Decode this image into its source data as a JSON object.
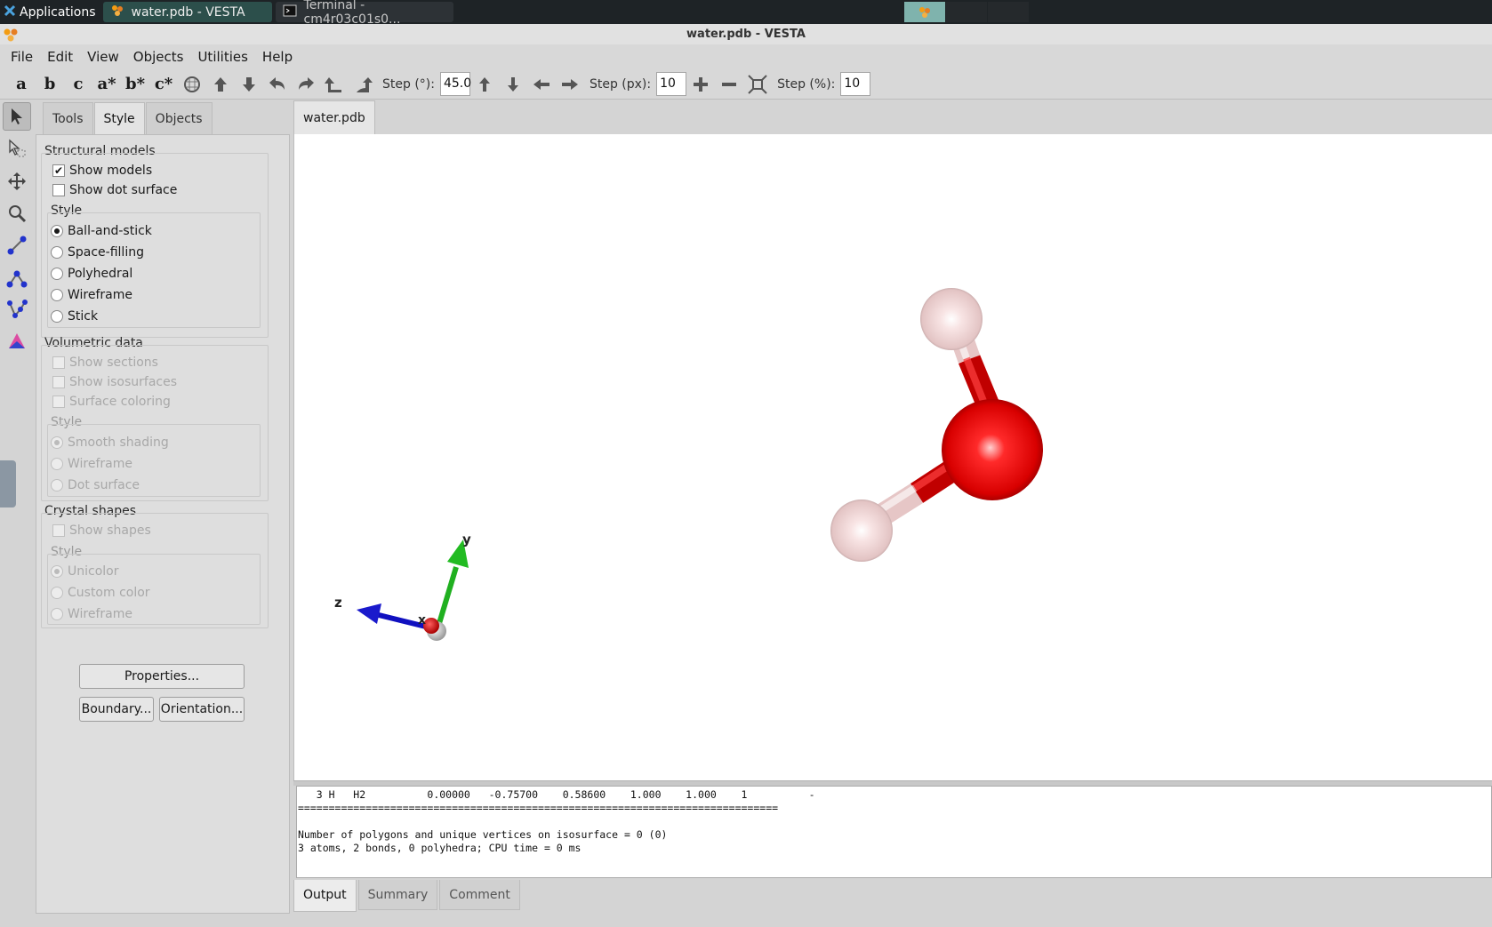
{
  "taskbar": {
    "apps_label": "Applications",
    "tasks": [
      {
        "label": "water.pdb - VESTA",
        "active": true
      },
      {
        "label": "Terminal - cm4r03c01s0...",
        "active": false
      }
    ]
  },
  "window": {
    "title": "water.pdb - VESTA"
  },
  "menu": [
    "File",
    "Edit",
    "View",
    "Objects",
    "Utilities",
    "Help"
  ],
  "toolbar": {
    "axis_buttons": [
      "a",
      "b",
      "c",
      "a*",
      "b*",
      "c*"
    ],
    "step_deg_label": "Step (°):",
    "step_deg_value": "45.0",
    "step_px_label": "Step (px):",
    "step_px_value": "10",
    "step_pct_label": "Step (%):",
    "step_pct_value": "10"
  },
  "panel": {
    "tabs": [
      "Tools",
      "Style",
      "Objects"
    ],
    "active_tab": "Style",
    "structural": {
      "title": "Structural models",
      "show_models": "Show models",
      "show_models_checked": true,
      "show_dot_surface": "Show dot surface",
      "style_title": "Style",
      "styles": [
        "Ball-and-stick",
        "Space-filling",
        "Polyhedral",
        "Wireframe",
        "Stick"
      ],
      "selected_style": "Ball-and-stick"
    },
    "volumetric": {
      "title": "Volumetric data",
      "checks": [
        "Show sections",
        "Show isosurfaces",
        "Surface coloring"
      ],
      "style_title": "Style",
      "styles": [
        "Smooth shading",
        "Wireframe",
        "Dot surface"
      ]
    },
    "crystal": {
      "title": "Crystal shapes",
      "show_shapes": "Show shapes",
      "style_title": "Style",
      "styles": [
        "Unicolor",
        "Custom color",
        "Wireframe"
      ]
    },
    "buttons": {
      "properties": "Properties...",
      "boundary": "Boundary...",
      "orientation": "Orientation..."
    }
  },
  "document_tab": "water.pdb",
  "axes": {
    "x": "x",
    "y": "y",
    "z": "z"
  },
  "colors": {
    "oxygen": "#e00000",
    "hydrogen": "#f2d8d8",
    "x_axis": "#cc0000",
    "y_axis": "#22bb22",
    "z_axis": "#1a1acc"
  },
  "output": {
    "lines": [
      "   3 H   H2          0.00000   -0.75700    0.58600    1.000    1.000    1          -",
      "==============================================================================",
      "",
      "Number of polygons and unique vertices on isosurface = 0 (0)",
      "3 atoms, 2 bonds, 0 polyhedra; CPU time = 0 ms"
    ]
  },
  "output_tabs": [
    "Output",
    "Summary",
    "Comment"
  ],
  "active_output_tab": "Output"
}
